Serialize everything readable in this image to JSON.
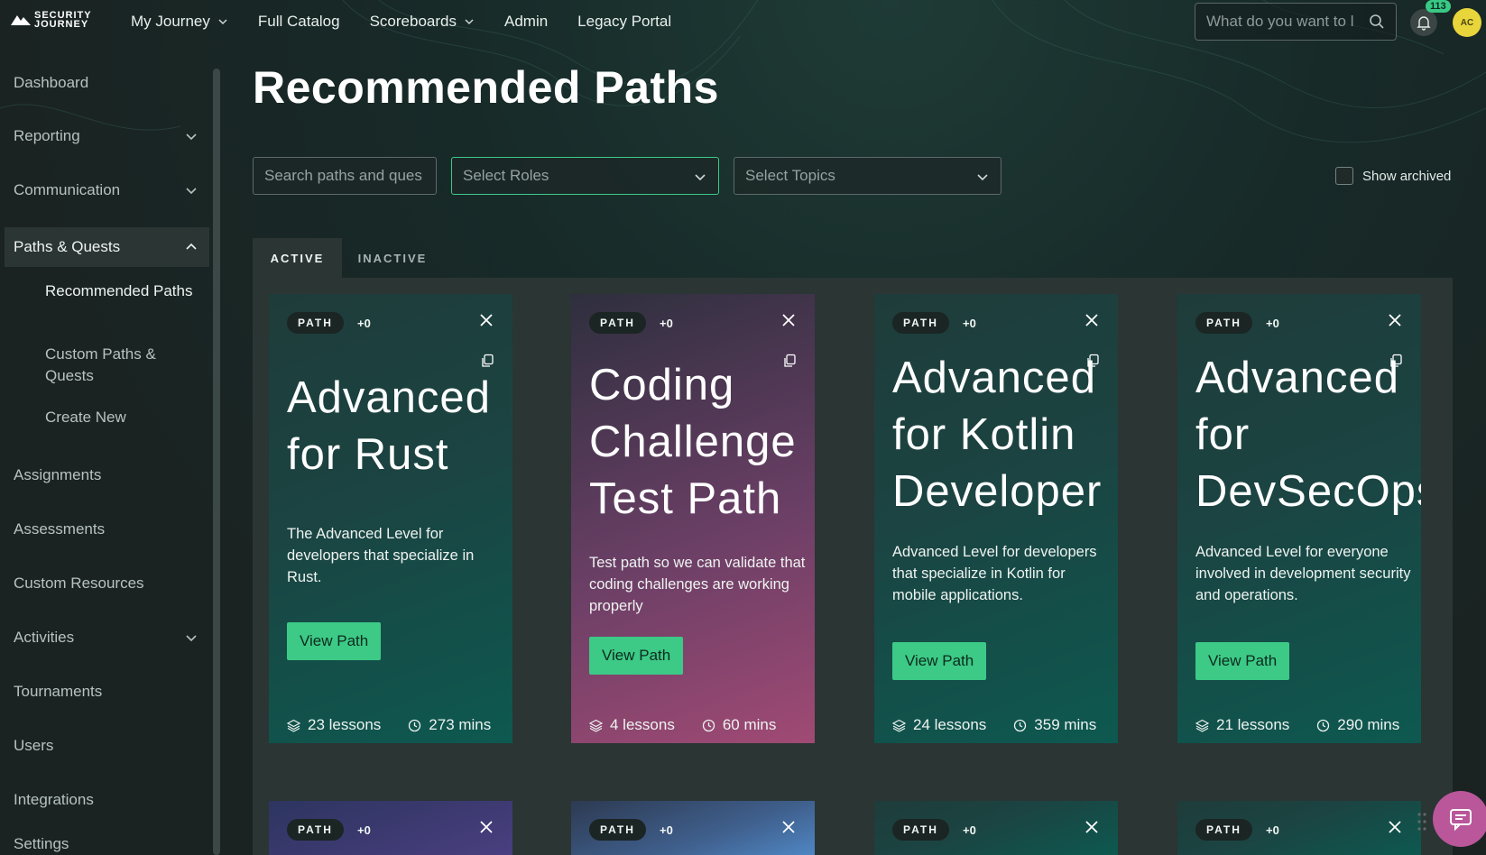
{
  "brand": {
    "line1": "SECURITY",
    "line2": "JOURNEY"
  },
  "nav": [
    {
      "label": "My Journey",
      "has_menu": true
    },
    {
      "label": "Full Catalog",
      "has_menu": false
    },
    {
      "label": "Scoreboards",
      "has_menu": true
    },
    {
      "label": "Admin",
      "has_menu": false
    },
    {
      "label": "Legacy Portal",
      "has_menu": false
    }
  ],
  "top_search": {
    "placeholder": "What do you want to l"
  },
  "notifications": {
    "count": "113"
  },
  "user": {
    "initials": "AC"
  },
  "sidebar": {
    "items": [
      {
        "label": "Dashboard"
      },
      {
        "label": "Reporting",
        "expand": "down"
      },
      {
        "label": "Communication",
        "expand": "down"
      },
      {
        "label": "Paths & Quests",
        "expand": "up",
        "active": true
      },
      {
        "label": "Assignments"
      },
      {
        "label": "Assessments"
      },
      {
        "label": "Custom Resources"
      },
      {
        "label": "Activities",
        "expand": "down"
      },
      {
        "label": "Tournaments"
      },
      {
        "label": "Users"
      },
      {
        "label": "Integrations"
      },
      {
        "label": "Settings"
      }
    ],
    "sub_items": [
      {
        "label": "Recommended Paths",
        "current": true
      },
      {
        "label": "Custom Paths & Quests"
      },
      {
        "label": "Create New"
      }
    ]
  },
  "main": {
    "title": "Recommended Paths",
    "search_placeholder": "Search paths and ques",
    "roles_placeholder": "Select Roles",
    "topics_placeholder": "Select Topics",
    "show_archived": "Show archived",
    "tabs": [
      {
        "label": "ACTIVE",
        "active": true
      },
      {
        "label": "INACTIVE",
        "active": false
      }
    ]
  },
  "cards": [
    {
      "type": "PATH",
      "plus": "+0",
      "title_lines": [
        "Advanced",
        "for Rust"
      ],
      "description": "The Advanced Level for developers that specialize in Rust.",
      "button": "View Path",
      "lessons": "23 lessons",
      "duration": "273 mins",
      "theme": "teal"
    },
    {
      "type": "PATH",
      "plus": "+0",
      "title_lines": [
        "Coding",
        "Challenge",
        "Test Path"
      ],
      "description": "Test path so we can validate that coding challenges are working properly",
      "button": "View Path",
      "lessons": "4 lessons",
      "duration": "60 mins",
      "theme": "pink"
    },
    {
      "type": "PATH",
      "plus": "+0",
      "title_lines": [
        "Advanced",
        "for Kotlin",
        "Developer"
      ],
      "description": "Advanced Level for developers that specialize in Kotlin for mobile applications.",
      "button": "View Path",
      "lessons": "24 lessons",
      "duration": "359 mins",
      "theme": "teal"
    },
    {
      "type": "PATH",
      "plus": "+0",
      "title_lines": [
        "Advanced",
        "for",
        "DevSecOps"
      ],
      "description": "Advanced Level for everyone involved in development security and operations.",
      "button": "View Path",
      "lessons": "21 lessons",
      "duration": "290 mins",
      "theme": "teal"
    }
  ],
  "cards_row2": [
    {
      "type": "PATH",
      "plus": "+0",
      "theme": "indigo"
    },
    {
      "type": "PATH",
      "plus": "+0",
      "theme": "blue"
    },
    {
      "type": "PATH",
      "plus": "+0",
      "theme": "teal"
    },
    {
      "type": "PATH",
      "plus": "+0",
      "theme": "teal"
    }
  ],
  "icons": {
    "search": "search-icon",
    "bell": "bell-icon",
    "close": "close-icon",
    "copy": "copy-icon",
    "lessons": "layers-icon",
    "duration": "clock-icon",
    "chat": "chat-icon"
  },
  "colors": {
    "accent": "#3cca86",
    "badge": "#38c985",
    "avatar": "#e8d53b",
    "chat": "#b9579a"
  }
}
